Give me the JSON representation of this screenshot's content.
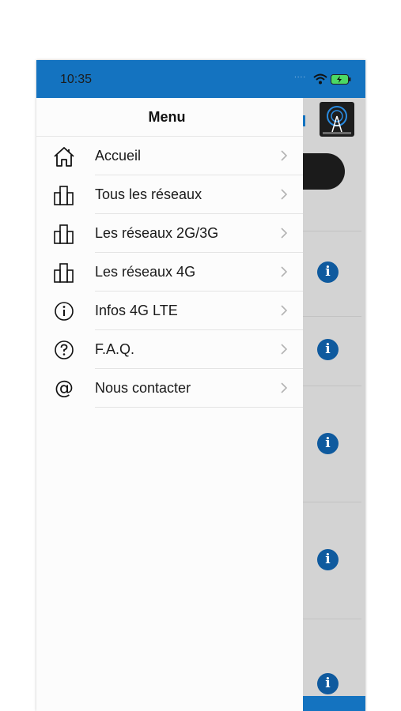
{
  "status_bar": {
    "time": "10:35",
    "background": "#1473c0"
  },
  "drawer": {
    "title": "Menu",
    "items": [
      {
        "label": "Accueil",
        "icon": "home-icon"
      },
      {
        "label": "Tous les réseaux",
        "icon": "buildings-icon"
      },
      {
        "label": "Les réseaux 2G/3G",
        "icon": "buildings-icon"
      },
      {
        "label": "Les réseaux 4G",
        "icon": "buildings-icon"
      },
      {
        "label": "Infos 4G LTE",
        "icon": "info-circle-icon"
      },
      {
        "label": "F.A.Q.",
        "icon": "question-circle-icon"
      },
      {
        "label": "Nous contacter",
        "icon": "at-sign-icon"
      }
    ]
  },
  "background_app": {
    "info_icon_glyph": "i",
    "info_icon_color": "#0f5a9e",
    "accent": "#1473c0"
  }
}
